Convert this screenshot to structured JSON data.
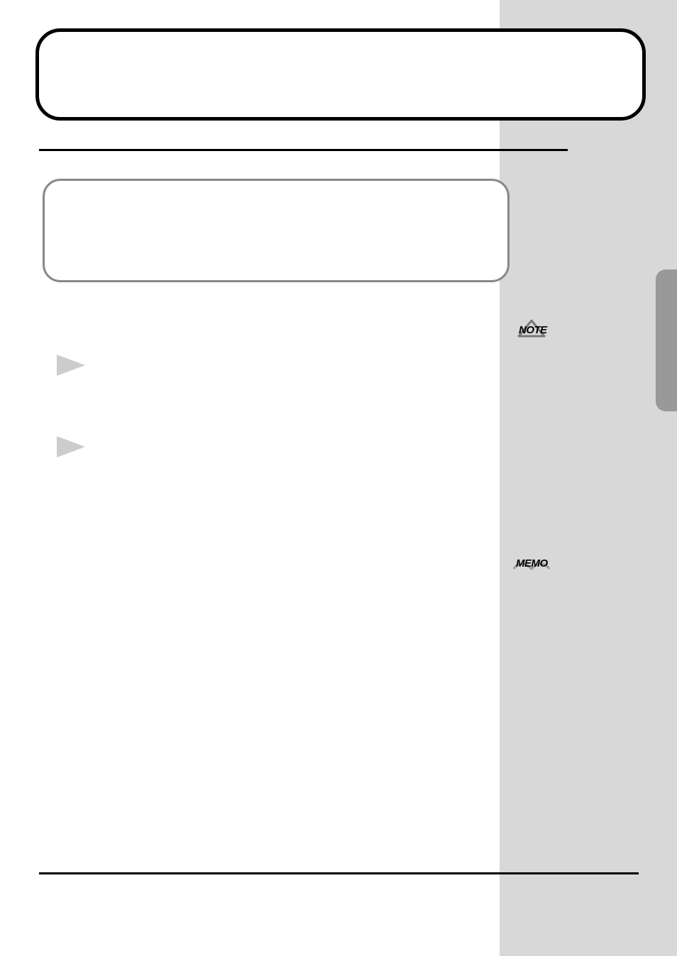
{
  "icons": {
    "note_label": "NOTE",
    "memo_label": "MEMO"
  }
}
